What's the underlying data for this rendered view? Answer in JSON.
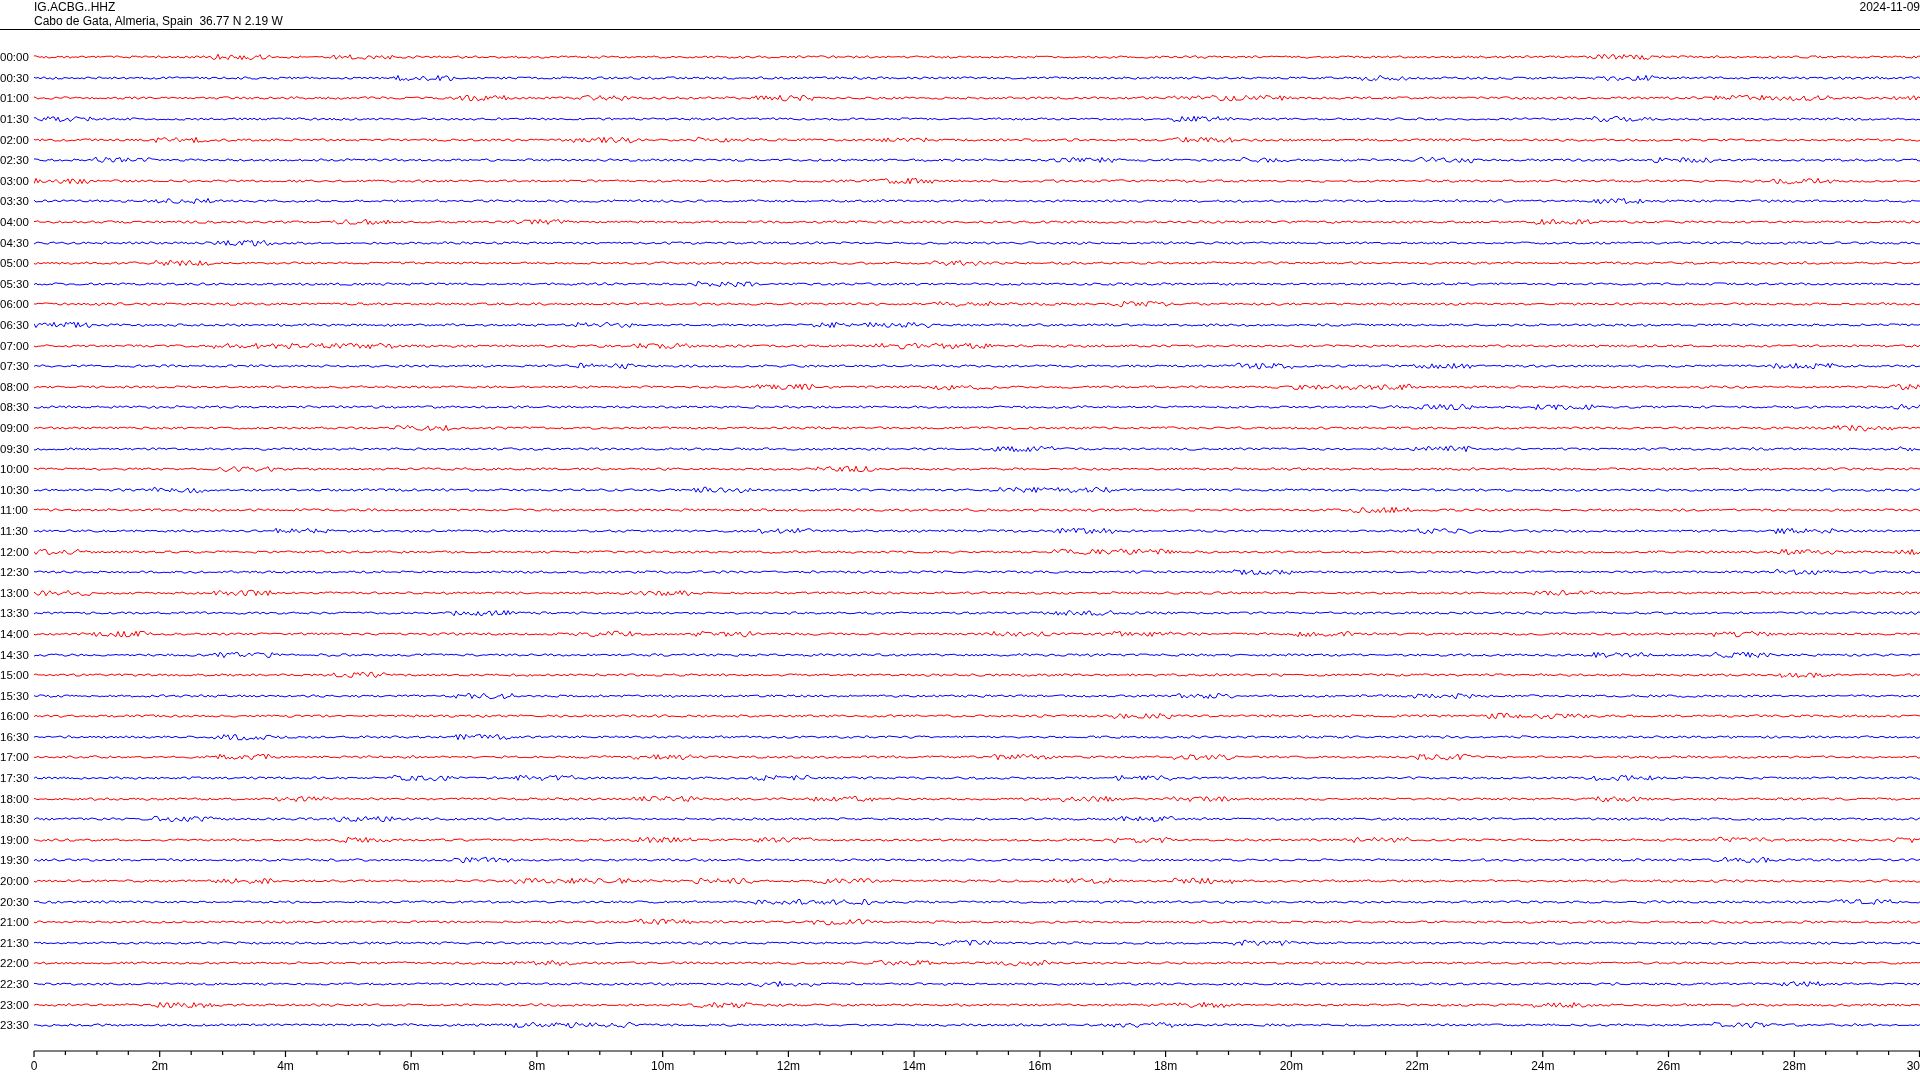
{
  "header": {
    "station": "IG.ACBG..HHZ",
    "location": "Cabo de Gata, Almeria, Spain  36.77 N 2.19 W",
    "date": "2024-11-09"
  },
  "traces": [
    {
      "time": "00:00",
      "color": "#ff0000"
    },
    {
      "time": "00:30",
      "color": "#0000ff"
    },
    {
      "time": "01:00",
      "color": "#ff0000"
    },
    {
      "time": "01:30",
      "color": "#0000ff"
    },
    {
      "time": "02:00",
      "color": "#ff0000"
    },
    {
      "time": "02:30",
      "color": "#0000ff"
    },
    {
      "time": "03:00",
      "color": "#ff0000"
    },
    {
      "time": "03:30",
      "color": "#0000ff"
    },
    {
      "time": "04:00",
      "color": "#ff0000"
    },
    {
      "time": "04:30",
      "color": "#0000ff"
    },
    {
      "time": "05:00",
      "color": "#ff0000"
    },
    {
      "time": "05:30",
      "color": "#0000ff"
    },
    {
      "time": "06:00",
      "color": "#ff0000"
    },
    {
      "time": "06:30",
      "color": "#0000ff"
    },
    {
      "time": "07:00",
      "color": "#ff0000"
    },
    {
      "time": "07:30",
      "color": "#0000ff"
    },
    {
      "time": "08:00",
      "color": "#ff0000"
    },
    {
      "time": "08:30",
      "color": "#0000ff"
    },
    {
      "time": "09:00",
      "color": "#ff0000"
    },
    {
      "time": "09:30",
      "color": "#0000ff"
    },
    {
      "time": "10:00",
      "color": "#ff0000"
    },
    {
      "time": "10:30",
      "color": "#0000ff"
    },
    {
      "time": "11:00",
      "color": "#ff0000"
    },
    {
      "time": "11:30",
      "color": "#0000ff"
    },
    {
      "time": "12:00",
      "color": "#ff0000"
    },
    {
      "time": "12:30",
      "color": "#0000ff"
    },
    {
      "time": "13:00",
      "color": "#ff0000"
    },
    {
      "time": "13:30",
      "color": "#0000ff"
    },
    {
      "time": "14:00",
      "color": "#ff0000"
    },
    {
      "time": "14:30",
      "color": "#0000ff"
    },
    {
      "time": "15:00",
      "color": "#ff0000"
    },
    {
      "time": "15:30",
      "color": "#0000ff"
    },
    {
      "time": "16:00",
      "color": "#ff0000"
    },
    {
      "time": "16:30",
      "color": "#0000ff"
    },
    {
      "time": "17:00",
      "color": "#ff0000"
    },
    {
      "time": "17:30",
      "color": "#0000ff"
    },
    {
      "time": "18:00",
      "color": "#ff0000"
    },
    {
      "time": "18:30",
      "color": "#0000ff"
    },
    {
      "time": "19:00",
      "color": "#ff0000"
    },
    {
      "time": "19:30",
      "color": "#0000ff"
    },
    {
      "time": "20:00",
      "color": "#ff0000"
    },
    {
      "time": "20:30",
      "color": "#0000ff"
    },
    {
      "time": "21:00",
      "color": "#ff0000"
    },
    {
      "time": "21:30",
      "color": "#0000ff"
    },
    {
      "time": "22:00",
      "color": "#ff0000"
    },
    {
      "time": "22:30",
      "color": "#0000ff"
    },
    {
      "time": "23:00",
      "color": "#ff0000"
    },
    {
      "time": "23:30",
      "color": "#0000ff"
    }
  ],
  "axis": {
    "tick_labels": [
      "0",
      "2m",
      "4m",
      "6m",
      "8m",
      "10m",
      "12m",
      "14m",
      "16m",
      "18m",
      "20m",
      "22m",
      "24m",
      "26m",
      "28m",
      "30"
    ]
  }
}
